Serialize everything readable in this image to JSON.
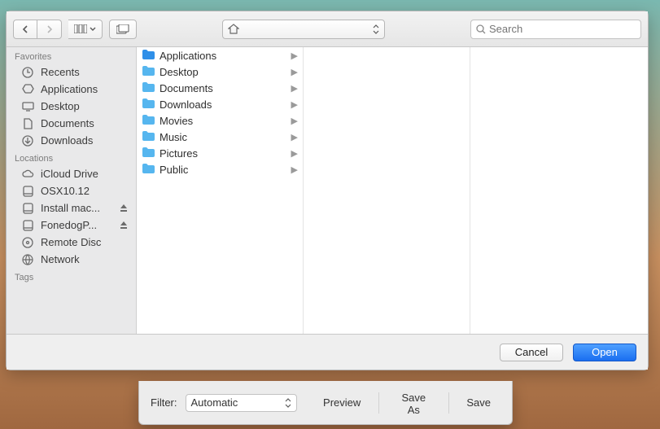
{
  "toolbar": {
    "path_label": "",
    "search_placeholder": "Search"
  },
  "sidebar": {
    "sections": [
      {
        "header": "Favorites",
        "items": [
          {
            "icon": "clock-icon",
            "label": "Recents"
          },
          {
            "icon": "apps-icon",
            "label": "Applications"
          },
          {
            "icon": "desktop-icon",
            "label": "Desktop"
          },
          {
            "icon": "documents-icon",
            "label": "Documents"
          },
          {
            "icon": "downloads-icon",
            "label": "Downloads"
          }
        ]
      },
      {
        "header": "Locations",
        "items": [
          {
            "icon": "cloud-icon",
            "label": "iCloud Drive"
          },
          {
            "icon": "disk-icon",
            "label": "OSX10.12"
          },
          {
            "icon": "disk-icon",
            "label": "Install mac...",
            "eject": true
          },
          {
            "icon": "disk-icon",
            "label": "FonedogP...",
            "eject": true
          },
          {
            "icon": "disc-icon",
            "label": "Remote Disc"
          },
          {
            "icon": "globe-icon",
            "label": "Network"
          }
        ]
      },
      {
        "header": "Tags",
        "items": []
      }
    ]
  },
  "columns": [
    {
      "items": [
        {
          "label": "Applications",
          "color": "#2f8fe8"
        },
        {
          "label": "Desktop",
          "color": "#56b6ef"
        },
        {
          "label": "Documents",
          "color": "#56b6ef"
        },
        {
          "label": "Downloads",
          "color": "#56b6ef"
        },
        {
          "label": "Movies",
          "color": "#56b6ef"
        },
        {
          "label": "Music",
          "color": "#56b6ef"
        },
        {
          "label": "Pictures",
          "color": "#56b6ef"
        },
        {
          "label": "Public",
          "color": "#56b6ef"
        }
      ]
    },
    {
      "items": []
    },
    {
      "items": []
    }
  ],
  "footer": {
    "cancel": "Cancel",
    "open": "Open"
  },
  "bottom": {
    "filter_label": "Filter:",
    "filter_value": "Automatic",
    "preview": "Preview",
    "save_as": "Save As",
    "save": "Save"
  }
}
